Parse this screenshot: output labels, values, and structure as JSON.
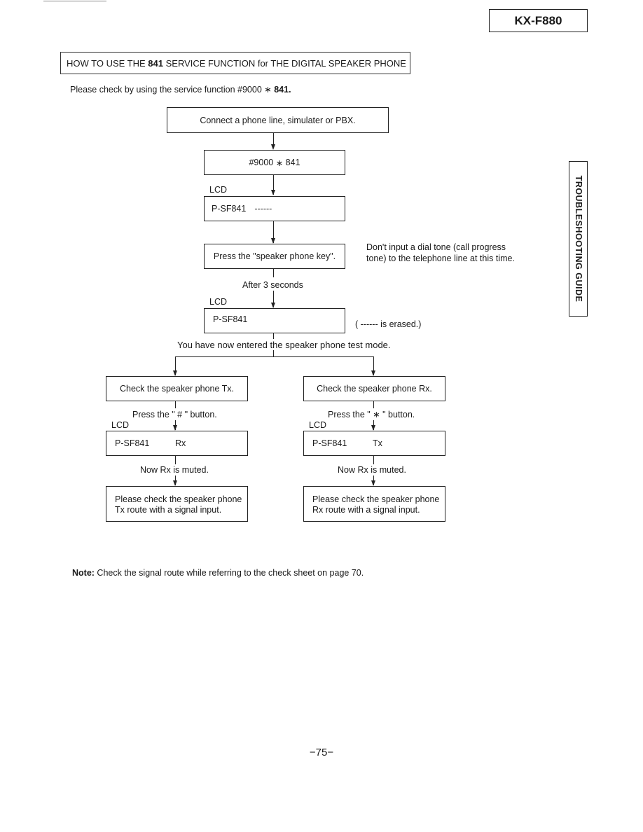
{
  "header": {
    "model": "KX-F880",
    "side_tab": "TROUBLESHOOTING GUIDE"
  },
  "section": {
    "title_prefix": "HOW TO USE THE ",
    "title_bold": "841",
    "title_suffix": " SERVICE FUNCTION for THE DIGITAL SPEAKER PHONE",
    "intro_prefix": "Please check by using the service function #9000 ",
    "intro_star": "∗",
    "intro_bold": " 841."
  },
  "flow": {
    "step1": "Connect a phone line, simulater or PBX.",
    "step2_prefix": "#9000 ",
    "step2_star": "∗",
    "step2_suffix": " 841",
    "lcd_label": "LCD",
    "lcd1": "P-SF841",
    "lcd1_dashes": "------",
    "step3": "Press the \"speaker phone key\".",
    "step3_note_line1": "Don't input a dial tone (call progress",
    "step3_note_line2": "tone) to the telephone line at this time.",
    "wait_label": "After 3 seconds",
    "lcd2": "P-SF841",
    "lcd2_note": "( ------  is erased.)",
    "test_mode": "You have now entered the speaker phone test mode.",
    "branches": [
      {
        "check": "Check the speaker phone Tx.",
        "press": "Press the \" # \" button.",
        "lcd_label": "LCD",
        "lcd_code": "P-SF841",
        "lcd_mode": "Rx",
        "status": "Now Rx is muted.",
        "result_line1": "Please check the speaker phone",
        "result_line2": "Tx route with a signal input."
      },
      {
        "check": "Check the speaker phone Rx.",
        "press": "Press the \" ∗ \" button.",
        "lcd_label": "LCD",
        "lcd_code": "P-SF841",
        "lcd_mode": "Tx",
        "status": "Now Rx is muted.",
        "result_line1": "Please check the speaker phone",
        "result_line2": "Rx route with a signal input."
      }
    ]
  },
  "note": {
    "label": "Note:",
    "text": " Check the signal route while referring to the check sheet on page 70."
  },
  "footer": {
    "page_number": "−75−"
  }
}
